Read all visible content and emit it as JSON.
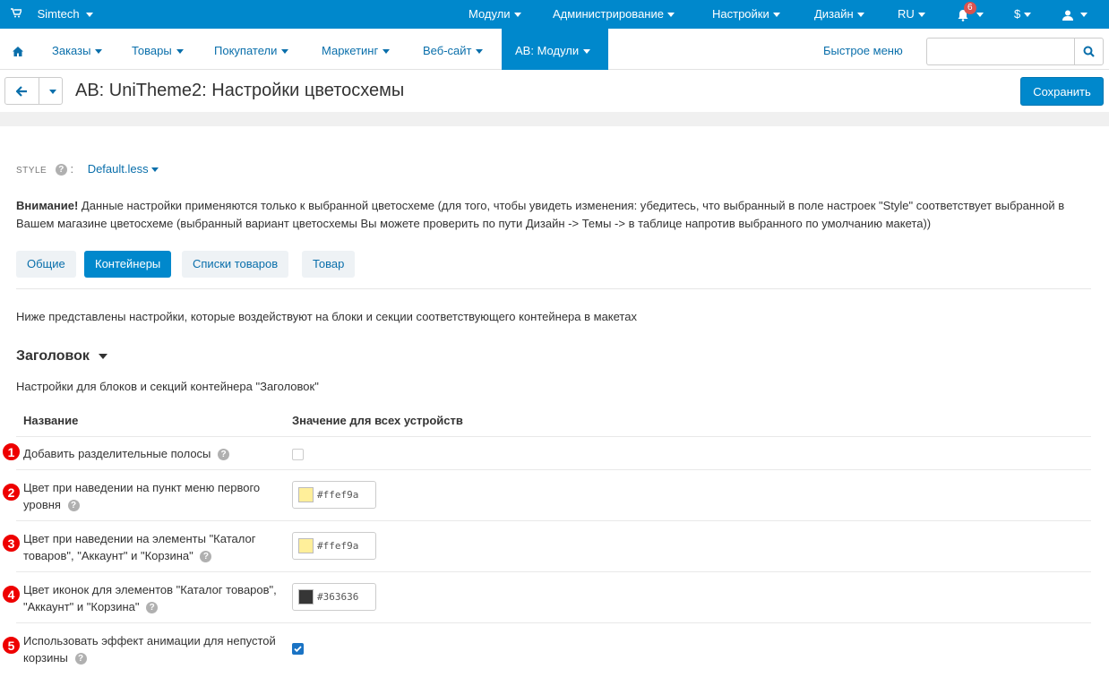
{
  "topbar": {
    "brand": "Simtech",
    "menus": [
      "Модули",
      "Администрирование",
      "Настройки",
      "Дизайн",
      "RU"
    ],
    "notifications_count": "6",
    "currency": "$"
  },
  "nav": {
    "items": [
      "Заказы",
      "Товары",
      "Покупатели",
      "Маркетинг",
      "Веб-сайт",
      "AB: Модули"
    ],
    "quick_menu": "Быстрое меню",
    "search_placeholder": ""
  },
  "header": {
    "title": "AB: UniTheme2: Настройки цветосхемы",
    "save_label": "Сохранить"
  },
  "style": {
    "label": "STYLE",
    "value": "Default.less"
  },
  "notice": {
    "bold": "Внимание!",
    "text": " Данные настройки применяются только к выбранной цветосхеме (для того, чтобы увидеть изменения: убедитесь, что выбранный в поле настроек \"Style\" соответствует выбранной в Вашем магазине цветосхеме (выбранный вариант цветосхемы Вы можете проверить по пути Дизайн -> Темы -> в таблице напротив выбранного по умолчанию макета))"
  },
  "tabs": [
    "Общие",
    "Контейнеры",
    "Списки товаров",
    "Товар"
  ],
  "active_tab": "Контейнеры",
  "intro": "Ниже представлены настройки, которые воздействуют на блоки и секции соответствующего контейнера в макетах",
  "section": {
    "title": "Заголовок",
    "description": "Настройки для блоков и секций контейнера \"Заголовок\"",
    "col_name": "Название",
    "col_value": "Значение для всех устройств",
    "rows": [
      {
        "num": "1",
        "label": "Добавить разделительные полосы",
        "type": "checkbox",
        "checked": false
      },
      {
        "num": "2",
        "label": "Цвет при наведении на пункт меню первого уровня",
        "type": "color",
        "value": "#ffef9a"
      },
      {
        "num": "3",
        "label": "Цвет при наведении на элементы \"Каталог товаров\", \"Аккаунт\" и \"Корзина\"",
        "type": "color",
        "value": "#ffef9a"
      },
      {
        "num": "4",
        "label": "Цвет иконок для элементов \"Каталог товаров\", \"Аккаунт\" и \"Корзина\"",
        "type": "color",
        "value": "#363636"
      },
      {
        "num": "5",
        "label": "Использовать эффект анимации для непустой корзины",
        "type": "checkbox",
        "checked": true
      }
    ]
  },
  "colors": {
    "primary": "#0088cc",
    "marker": "#ee0000"
  }
}
